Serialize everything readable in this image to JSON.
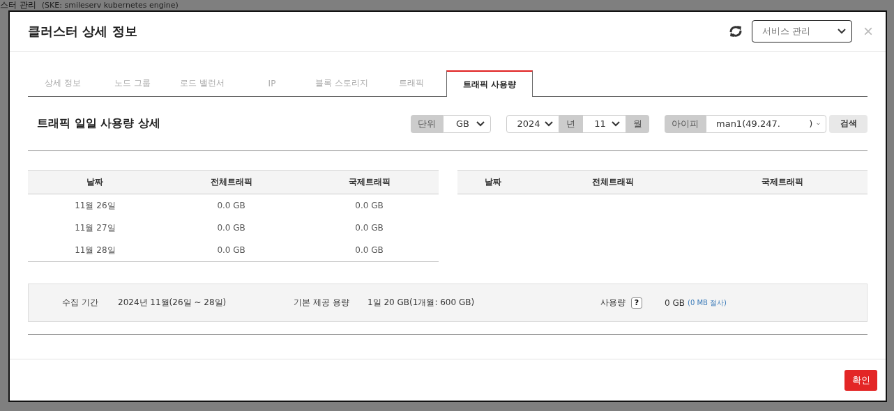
{
  "backdrop": {
    "title": "스터 관리",
    "subtitle": "(SKE: smileserv kubernetes engine)"
  },
  "dialog": {
    "title": "클러스터 상세 정보",
    "service_select": {
      "value": "서비스 관리"
    },
    "close": "×"
  },
  "tabs": [
    {
      "label": "상세 정보",
      "selected": false
    },
    {
      "label": "노드 그룹",
      "selected": false
    },
    {
      "label": "로드 밸런서",
      "selected": false
    },
    {
      "label": "IP",
      "selected": false
    },
    {
      "label": "블록 스토리지",
      "selected": false
    },
    {
      "label": "트래픽",
      "selected": false
    },
    {
      "label": "트래픽 사용량",
      "selected": true
    }
  ],
  "section": {
    "title": "트래픽 일일 사용량 상세"
  },
  "filters": {
    "unit": {
      "label": "단위",
      "value": "GB"
    },
    "year": {
      "value": "2024",
      "suffix": "년"
    },
    "month": {
      "value": "11",
      "suffix": "월"
    },
    "ip": {
      "label": "아이피",
      "value": "man1(49.247.          )"
    },
    "search_button": "검색"
  },
  "tables": [
    {
      "columns": [
        "날짜",
        "전체트래픽",
        "국제트래픽"
      ],
      "rows": [
        [
          "11월 26일",
          "0.0 GB",
          "0.0 GB"
        ],
        [
          "11월 27일",
          "0.0 GB",
          "0.0 GB"
        ],
        [
          "11월 28일",
          "0.0 GB",
          "0.0 GB"
        ]
      ]
    },
    {
      "columns": [
        "날짜",
        "전체트래픽",
        "국제트래픽"
      ]
    }
  ],
  "summary": [
    {
      "kind": "plain",
      "label": "수집 기간",
      "value": "2024년 11월(26일 ~ 28일)"
    },
    {
      "kind": "plain",
      "label": "기본 제공 용량",
      "value": "1일 20 GB(1개월: 600 GB)"
    },
    {
      "kind": "help",
      "label": "사용량",
      "help": "?",
      "value": "0 GB",
      "note": "(0 MB 절사)"
    }
  ],
  "footer": {
    "confirm_button": "확인"
  }
}
